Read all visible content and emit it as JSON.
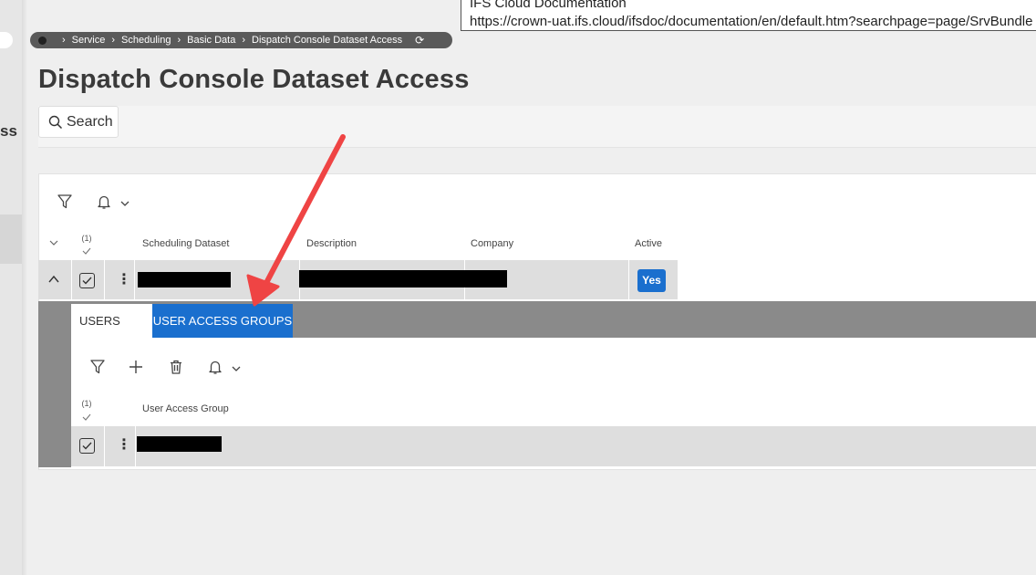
{
  "left_rail": {
    "fragment_text": "ss"
  },
  "tooltip": {
    "line1": "IFS Cloud Documentation",
    "line2": "https://crown-uat.ifs.cloud/ifsdoc/documentation/en/default.htm?searchpage=page/SrvBundle"
  },
  "breadcrumb": {
    "items": [
      "Service",
      "Scheduling",
      "Basic Data",
      "Dispatch Console Dataset Access"
    ],
    "refresh_glyph": "⟳"
  },
  "page_title": "Dispatch Console Dataset Access",
  "search": {
    "label": "Search"
  },
  "main_table": {
    "selection_count": "(1)",
    "columns": [
      "Scheduling Dataset",
      "Description",
      "Company",
      "Active"
    ],
    "row": {
      "active": "Yes"
    }
  },
  "detail": {
    "tabs": [
      "USERS",
      "USER ACCESS GROUPS"
    ],
    "active_tab": "USER ACCESS GROUPS",
    "selection_count": "(1)",
    "columns": [
      "User Access Group"
    ]
  },
  "colors": {
    "accent": "#1a6fce",
    "annotation_arrow": "#ef4444",
    "breadcrumb_bg": "#5a5a5a",
    "detail_band": "#8a8a8a"
  }
}
